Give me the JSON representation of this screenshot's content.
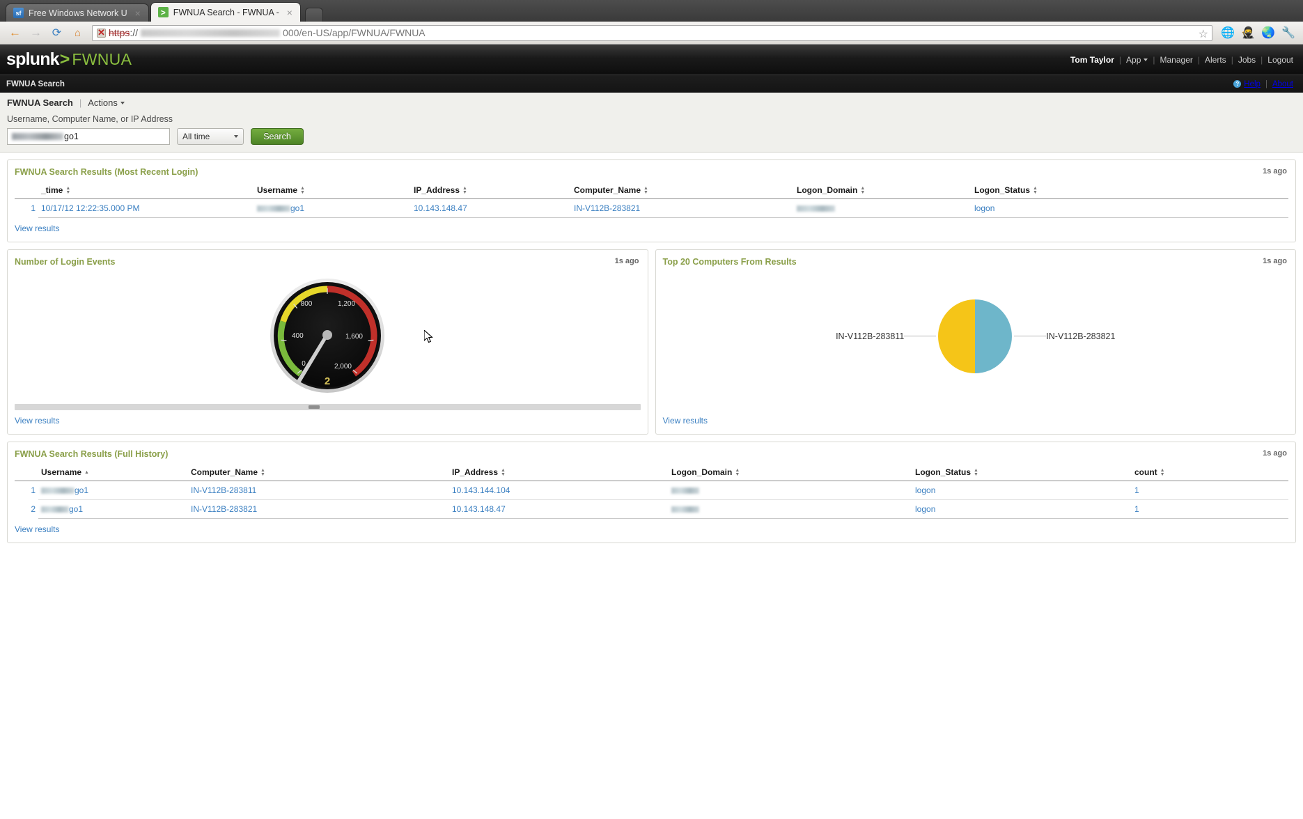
{
  "browser": {
    "tabs": [
      {
        "title": "Free Windows Network U",
        "favicon": "sf-icon",
        "active": false
      },
      {
        "title": "FWNUA Search - FWNUA -",
        "favicon": "splunk-icon",
        "active": true
      }
    ],
    "new_tab_label": "",
    "nav": {
      "back": "back-arrow-icon",
      "forward": "forward-arrow-icon",
      "reload": "reload-icon",
      "home": "home-icon"
    },
    "url": {
      "scheme": "https",
      "separator": "://",
      "host_redacted": true,
      "rest": "000/en-US/app/FWNUA/FWNUA"
    },
    "toolbar_icons": [
      "bookmark-star-icon",
      "globe-icon",
      "incognito-mask-icon",
      "browser-globe-icon",
      "wrench-icon"
    ]
  },
  "splunk_header": {
    "logo_text": "splunk",
    "logo_chevron": ">",
    "app_name": "FWNUA",
    "user": "Tom Taylor",
    "nav_items": [
      "App",
      "Manager",
      "Alerts",
      "Jobs",
      "Logout"
    ]
  },
  "subnav": {
    "left_label": "FWNUA Search",
    "help_label": "Help",
    "about_label": "About"
  },
  "search_form": {
    "breadcrumb_title": "FWNUA Search",
    "actions_label": "Actions",
    "field_label": "Username, Computer Name, or IP Address",
    "input_value_suffix": "go1",
    "input_placeholder": "",
    "time_range": "All time",
    "search_button": "Search"
  },
  "panels": {
    "most_recent": {
      "title": "FWNUA Search Results (Most Recent Login)",
      "age": "1s ago",
      "columns": [
        "_time",
        "Username",
        "IP_Address",
        "Computer_Name",
        "Logon_Domain",
        "Logon_Status"
      ],
      "rows": [
        {
          "num": "1",
          "_time": "10/17/12 12:22:35.000 PM",
          "Username": "go1",
          "IP_Address": "10.143.148.47",
          "Computer_Name": "IN-V112B-283821",
          "Logon_Domain": "",
          "Logon_Status": "logon"
        }
      ],
      "view_results": "View results"
    },
    "login_events": {
      "title": "Number of Login Events",
      "age": "1s ago",
      "view_results": "View results"
    },
    "top_computers": {
      "title": "Top 20 Computers From Results",
      "age": "1s ago",
      "view_results": "View results"
    },
    "full_history": {
      "title": "FWNUA Search Results (Full History)",
      "age": "1s ago",
      "columns": [
        "Username",
        "Computer_Name",
        "IP_Address",
        "Logon_Domain",
        "Logon_Status",
        "count"
      ],
      "rows": [
        {
          "num": "1",
          "Username": "go1",
          "Computer_Name": "IN-V112B-283811",
          "IP_Address": "10.143.144.104",
          "Logon_Domain": "",
          "Logon_Status": "logon",
          "count": "1"
        },
        {
          "num": "2",
          "Username": "go1",
          "Computer_Name": "IN-V112B-283821",
          "IP_Address": "10.143.148.47",
          "Logon_Domain": "",
          "Logon_Status": "logon",
          "count": "1"
        }
      ],
      "view_results": "View results"
    }
  },
  "chart_data": [
    {
      "type": "gauge",
      "title": "Number of Login Events",
      "value": 2,
      "value_label": "2",
      "min": 0,
      "max": 2000,
      "ticks": [
        0,
        400,
        800,
        1200,
        1600,
        2000
      ],
      "tick_labels": [
        "0",
        "400",
        "800",
        "1,200",
        "1,600",
        "2,000"
      ],
      "ranges": [
        {
          "from": 0,
          "to": 600,
          "color": "#7aba3c"
        },
        {
          "from": 600,
          "to": 1000,
          "color": "#e6d72a"
        },
        {
          "from": 1000,
          "to": 2000,
          "color": "#c0302a"
        }
      ],
      "face_color": "#0a0a0a",
      "needle_color": "#d4d4d4",
      "value_color": "#d8c45a"
    },
    {
      "type": "pie",
      "title": "Top 20 Computers From Results",
      "labels": [
        "IN-V112B-283811",
        "IN-V112B-283821"
      ],
      "values": [
        1,
        1
      ],
      "percentages": [
        50,
        50
      ],
      "colors": [
        "#f5c518",
        "#6eb6ca"
      ],
      "legend": "labels-outside",
      "label_left": "IN-V112B-283811",
      "label_right": "IN-V112B-283821"
    }
  ],
  "colors": {
    "panel_title": "#8a9f49",
    "link": "#3a7fc1",
    "search_button": "#5a922e",
    "pie_yellow": "#f5c518",
    "pie_teal": "#6eb6ca",
    "gauge_green": "#7aba3c",
    "gauge_yellow": "#e6d72a",
    "gauge_red": "#c0302a"
  }
}
